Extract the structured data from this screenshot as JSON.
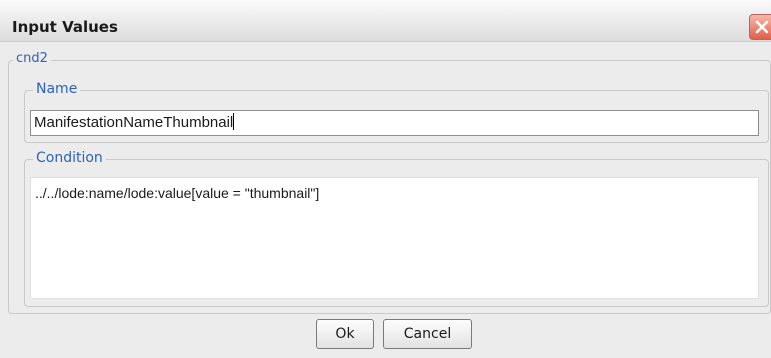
{
  "window": {
    "title": "Input Values",
    "close_icon": "close-icon"
  },
  "outer_group": {
    "legend": "cnd2"
  },
  "name_group": {
    "legend": "Name",
    "value": "ManifestationNameThumbnail"
  },
  "condition_group": {
    "legend": "Condition",
    "value": "../../lode:name/lode:value[value = \"thumbnail\"]"
  },
  "buttons": {
    "ok_label": "Ok",
    "cancel_label": "Cancel"
  },
  "colors": {
    "legend_text": "#2d63b8",
    "close_button": "#e0604a",
    "dialog_background": "#ececec"
  }
}
